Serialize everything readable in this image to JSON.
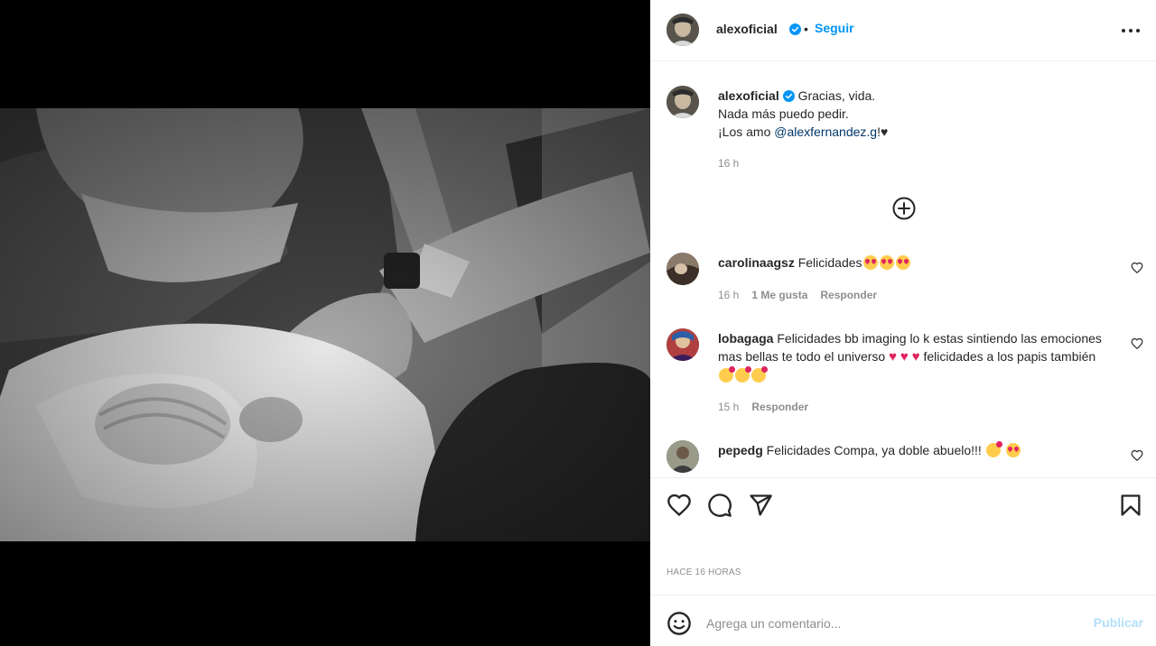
{
  "colors": {
    "accent": "#0095f6",
    "muted": "#8e8e8e",
    "mention": "#00376b",
    "publish_disabled": "#b2dffc"
  },
  "post": {
    "author": "alexoficial",
    "follow_label": "Seguir",
    "dot": "•",
    "caption": {
      "line1": "Gracias, vida.",
      "line2": "Nada más puedo pedir.",
      "line3_prefix": "¡Los amo ",
      "mention": "@alexfernandez.g",
      "line3_suffix": "!♥",
      "time": "16 h"
    },
    "posted_label": "HACE 16 HORAS"
  },
  "comments": [
    {
      "user": "carolinaagsz",
      "text": "Felicidades",
      "emojis": [
        "smiling-face-with-heart-eyes",
        "smiling-face-with-heart-eyes",
        "smiling-face-with-heart-eyes"
      ],
      "time": "16 h",
      "likes": "1 Me gusta",
      "reply": "Responder"
    },
    {
      "user": "lobagaga",
      "text_a": "Felicidades bb imaging lo k estas sintiendo las emociones mas bellas te todo el universo",
      "text_b": "felicidades a los papis también",
      "emojis_a": [
        "red-heart",
        "red-heart",
        "red-heart"
      ],
      "emojis_b": [
        "smiling-face-with-hearts",
        "smiling-face-with-hearts",
        "smiling-face-with-hearts"
      ],
      "time": "15 h",
      "reply": "Responder"
    },
    {
      "user": "pepedg",
      "text": "Felicidades Compa, ya doble abuelo!!!",
      "emojis": [
        "partying-face",
        "smiling-face-with-heart-eyes"
      ]
    }
  ],
  "add_comment": {
    "placeholder": "Agrega un comentario...",
    "publish_label": "Publicar"
  },
  "icons": {
    "more": "more-horizontal-icon",
    "load_more": "plus-circle-icon",
    "like": "heart-icon",
    "comment": "comment-bubble-icon",
    "share": "paper-plane-icon",
    "save": "bookmark-icon",
    "emoji": "smiley-icon",
    "verified": "verified-badge-icon"
  }
}
